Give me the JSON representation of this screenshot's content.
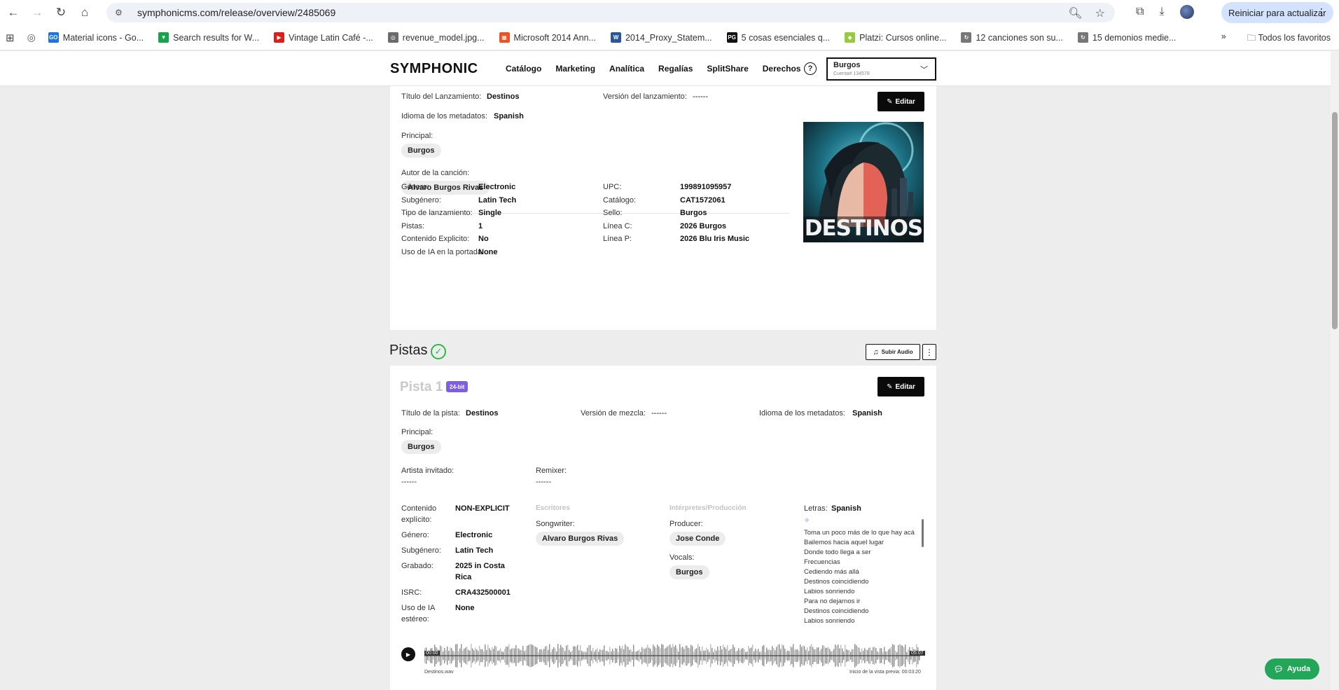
{
  "browser": {
    "url": "symphonicms.com/release/overview/2485069",
    "update_label": "Reiniciar para actualizar",
    "bookmarks": [
      {
        "label": "Material icons - Go...",
        "icon": "GO",
        "color": "#1a73e8"
      },
      {
        "label": "Search results for W...",
        "icon": "▼",
        "color": "#16a34a"
      },
      {
        "label": "Vintage Latin Café -...",
        "icon": "▶",
        "color": "#e01b1b"
      },
      {
        "label": "revenue_model.jpg...",
        "icon": "◎",
        "color": "#6b6b6b"
      },
      {
        "label": "Microsoft 2014 Ann...",
        "icon": "▦",
        "color": "#f25022"
      },
      {
        "label": "2014_Proxy_Statem...",
        "icon": "W",
        "color": "#2b579a"
      },
      {
        "label": "5 cosas esenciales q...",
        "icon": "PG",
        "color": "#111111"
      },
      {
        "label": "Platzi: Cursos online...",
        "icon": "◆",
        "color": "#98ca3f"
      },
      {
        "label": "12 canciones son su...",
        "icon": "↻",
        "color": "#777777"
      },
      {
        "label": "15 demonios medie...",
        "icon": "↻",
        "color": "#777777"
      }
    ],
    "all_favorites": "Todos los favoritos"
  },
  "header": {
    "logo": "SYMPHONIC",
    "nav": [
      "Catálogo",
      "Marketing",
      "Analítica",
      "Regalías",
      "SplitShare",
      "Derechos"
    ],
    "help": "?",
    "account_name": "Burgos",
    "account_sub": "Cuenta# 134578"
  },
  "release": {
    "title_label": "Título del Lanzamiento:",
    "title_value": "Destinos",
    "version_label": "Versión del lanzamiento:",
    "version_value": "------",
    "meta_lang_label": "Idioma de los metadatos:",
    "meta_lang_value": "Spanish",
    "primary_label": "Principal:",
    "primary_value": "Burgos",
    "author_label": "Autor de la canción:",
    "author_value": "Alvaro Burgos Rivas",
    "edit_label": "Editar",
    "cover_text": "DESTINOS",
    "left_fields": [
      {
        "label": "Género:",
        "value": "Electronic"
      },
      {
        "label": "Subgénero:",
        "value": "Latin Tech"
      },
      {
        "label": "Tipo de lanzamiento:",
        "value": "Single"
      },
      {
        "label": "Pistas:",
        "value": "1"
      },
      {
        "label": "Contenido Explicito:",
        "value": "No"
      },
      {
        "label": "Uso de IA en la portada:",
        "value": "None"
      }
    ],
    "right_fields": [
      {
        "label": "UPC:",
        "value": "199891095957"
      },
      {
        "label": "Catálogo:",
        "value": "CAT1572061"
      },
      {
        "label": "Sello:",
        "value": "Burgos"
      },
      {
        "label": "Línea C:",
        "value": "2026 Burgos"
      },
      {
        "label": "Línea P:",
        "value": "2026 Blu Iris Music"
      }
    ]
  },
  "tracks_section": {
    "title": "Pistas",
    "upload_label": "Subir Audio"
  },
  "track": {
    "title": "Pista 1",
    "badge": "24-bit",
    "edit_label": "Editar",
    "title_label": "Título de la pista:",
    "title_value": "Destinos",
    "mix_label": "Versión de mezcla:",
    "mix_value": "------",
    "meta_lang_label": "Idioma de los metadatos:",
    "meta_lang_value": "Spanish",
    "primary_label": "Principal:",
    "primary_value": "Burgos",
    "guest_label": "Artista invitado:",
    "guest_value": "------",
    "remixer_label": "Remixer:",
    "remixer_value": "------",
    "explicit_label_1": "Contenido",
    "explicit_label_2": "explícito:",
    "explicit_value": "NON-EXPLICIT",
    "genre_label": "Género:",
    "genre_value": "Electronic",
    "subgenre_label": "Subgénero:",
    "subgenre_value": "Latin Tech",
    "recorded_label": "Grabado:",
    "recorded_value_1": "2025 in Costa",
    "recorded_value_2": "Rica",
    "isrc_label": "ISRC:",
    "isrc_value": "CRA432500001",
    "ai_label_1": "Uso de IA",
    "ai_label_2": "estéreo:",
    "ai_value": "None",
    "writers_head": "Escritores",
    "songwriter_label": "Songwriter:",
    "songwriter_value": "Alvaro Burgos Rivas",
    "performers_head": "Intérpretes/Producción",
    "producer_label": "Producer:",
    "producer_value": "Jose Conde",
    "vocals_label": "Vocals:",
    "vocals_value": "Burgos",
    "lyrics_label": "Letras:",
    "lyrics_lang": "Spanish",
    "lyrics_lines": [
      "Toma un poco más de lo que hay acá",
      "Bailemos hacia aquel lugar",
      "Donde todo llega a ser",
      "Frecuencias",
      "Cediendo más allá",
      "Destinos coincidiendo",
      "Labios sonriendo",
      "Para no dejarnos ir",
      "Destinos coincidiendo",
      "Labios sonriendo"
    ],
    "player": {
      "start": "00:00",
      "end": "05:07",
      "file": "Destinos.wav",
      "preview": "Inicio de la vista previa: 00:03:20"
    }
  },
  "help_fab": "Ayuda"
}
